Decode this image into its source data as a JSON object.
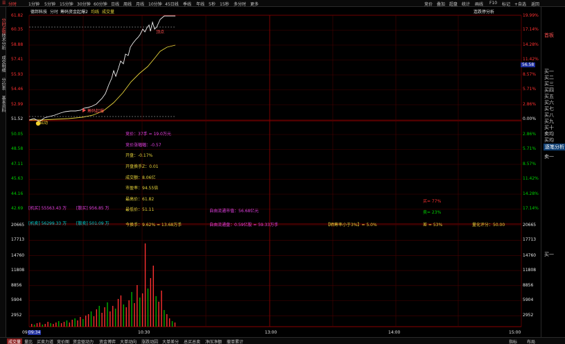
{
  "topbar": {
    "periods": [
      "分时",
      "1分钟",
      "5分钟",
      "15分钟",
      "30分钟",
      "60分钟",
      "日线",
      "周线",
      "月线",
      "10分钟",
      "45日线",
      "季线",
      "年线",
      "5秒",
      "15秒",
      "多分时",
      "更多"
    ],
    "active_period": "分时",
    "right_items": [
      "竞价",
      "叠加",
      "超盘",
      "统计",
      "画线",
      "F10",
      "标记",
      "+自选",
      "返回"
    ]
  },
  "left_tabs": [
    "分时走势",
    "技术分析",
    "成交明细",
    "分价表",
    "基本资料"
  ],
  "chart_header": {
    "stock_name": "德邦科技",
    "mode": "分时",
    "indicator": "筹码资金起爆2",
    "avg_label": "均线",
    "vol_label": "成交量",
    "top_right_btn": "连跌停分析"
  },
  "price_axis": {
    "left_labels": [
      "61.82",
      "60.35",
      "58.88",
      "57.41",
      "55.93",
      "54.46",
      "52.99",
      "51.52",
      "50.05",
      "48.58",
      "47.11",
      "45.63",
      "44.16",
      "42.69"
    ],
    "right_labels": [
      "19.99%",
      "17.14%",
      "14.28%",
      "11.42%",
      "8.57%",
      "5.71%",
      "2.86%",
      "0.00%",
      "2.86%",
      "5.71%",
      "8.57%",
      "11.42%",
      "14.28%",
      "17.14%"
    ],
    "current_price_tag": "56.58"
  },
  "volume_axis": {
    "labels": [
      "20665",
      "17713",
      "14760",
      "11808",
      "8856",
      "5904",
      "2952"
    ]
  },
  "time_axis": {
    "labels": [
      "09:30",
      "10:30",
      "13:00",
      "14:00",
      "15:00"
    ],
    "cursor_time": "09:34"
  },
  "info": {
    "auction_price": "竞价：37手 = 19.0万元",
    "auction_change": "竞价涨幅幅：-0.57",
    "open": "开盘：-0.17%",
    "open_turnover": "开盘换手Z：0.01",
    "turnover_amount": "成交额：8.06亿",
    "pe": "市盈率：94.55倍",
    "high": "最高价：61.82",
    "low": "最低价：51.11",
    "turnover": "今换手：9.62% = 13.68万手",
    "free_cap": "自由流通市值：56.68亿元",
    "free_share": "自由流通盘：0.59亿股 = 59.33万手",
    "chip_label": "【晒筹率小于3%】= 5.0%",
    "quant_score": "量化评分：50.00",
    "buy_pct": "买= 77%",
    "sell_pct": "卖= 23%",
    "diff_pct": "差 = 53%",
    "inst_buy": "[机买] 55563.43 万",
    "retail_buy": "[散买] 956.85 万",
    "inst_sell": "[机卖] 56299.33 万",
    "retail_sell": "[散卖] 501.09 万"
  },
  "markers": {
    "start_label": "启动",
    "burst_label": "筹码起爆",
    "top_label": "顶点"
  },
  "right_panel": {
    "title": "首板",
    "items": [
      "买一",
      "买二",
      "买三",
      "买四",
      "买五",
      "买六",
      "买七",
      "买八",
      "买九",
      "买十",
      "卖均",
      "买均"
    ],
    "detail_btn": "逐笔分析",
    "sell1": "卖一",
    "buy1": "买一"
  },
  "bottombar": {
    "tabs": [
      "成交量",
      "量比",
      "买卖力道",
      "竞价图",
      "资金驱动力",
      "资金博弈",
      "大单动向",
      "涨跌动因",
      "大单差分",
      "总买总卖",
      "净压净额",
      "撤单累计"
    ],
    "active_tab": "成交量",
    "right_items": [
      "指标",
      "布局"
    ]
  },
  "colors": {
    "up": "#ff3030",
    "down": "#00d000",
    "price_line": "#f0f0f0",
    "avg_line": "#e6d33a",
    "magenta": "#e040e0",
    "yellow": "#e6d33a"
  }
}
